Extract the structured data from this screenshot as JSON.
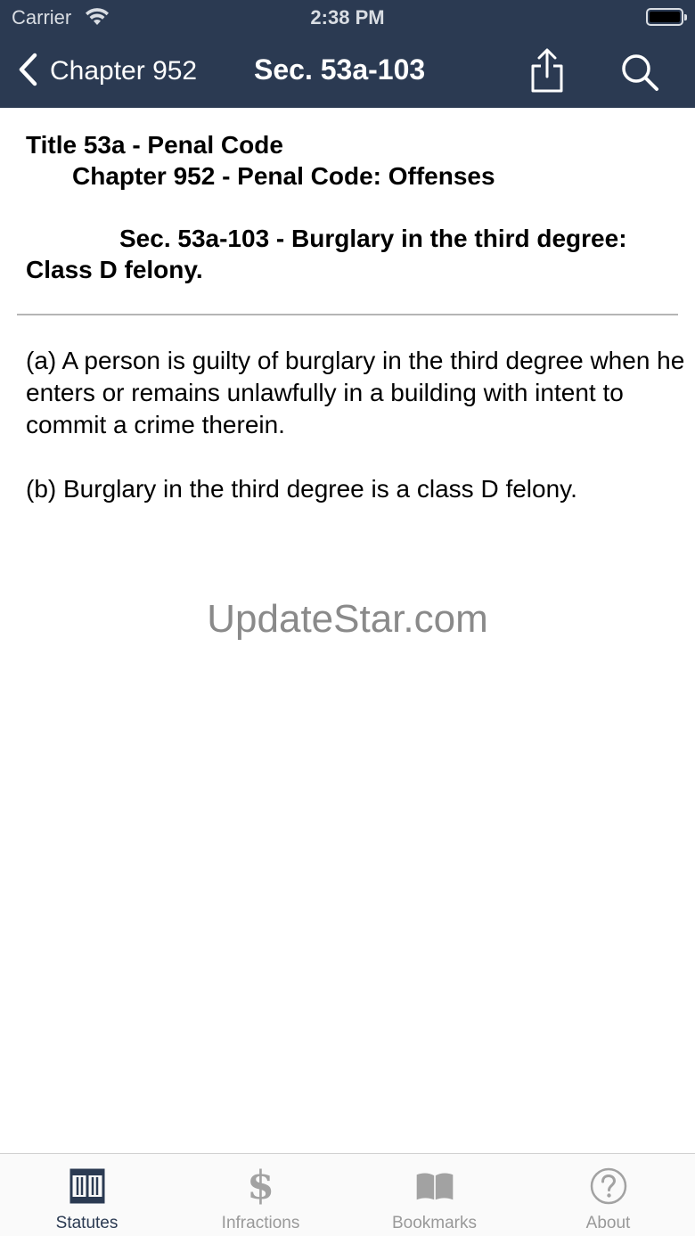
{
  "status_bar": {
    "carrier": "Carrier",
    "time": "2:38 PM"
  },
  "nav": {
    "back_label": "Chapter 952",
    "title": "Sec. 53a-103",
    "icons": [
      "chevron-left-icon",
      "share-icon",
      "search-icon"
    ]
  },
  "document": {
    "title_line_1": "Title 53a - Penal Code",
    "title_line_2": "Chapter 952 - Penal Code: Offenses",
    "section_line_1": "Sec. 53a-103 - Burglary in the third degree:",
    "section_line_2": "Class D felony.",
    "paragraphs": [
      "(a) A person is guilty of burglary in the third degree when he enters or remains unlawfully in a building with intent to commit a crime therein.",
      "(b) Burglary in the third degree is a class D felony."
    ]
  },
  "watermark": "UpdateStar.com",
  "tabs": [
    {
      "label": "Statutes",
      "icon": "book-columns-icon",
      "active": true
    },
    {
      "label": "Infractions",
      "icon": "dollar-icon",
      "active": false
    },
    {
      "label": "Bookmarks",
      "icon": "open-book-icon",
      "active": false
    },
    {
      "label": "About",
      "icon": "question-circle-icon",
      "active": false
    }
  ],
  "colors": {
    "header_bg": "#2b3a52",
    "tab_active": "#2b3a52",
    "tab_inactive": "#a2a2a2"
  }
}
